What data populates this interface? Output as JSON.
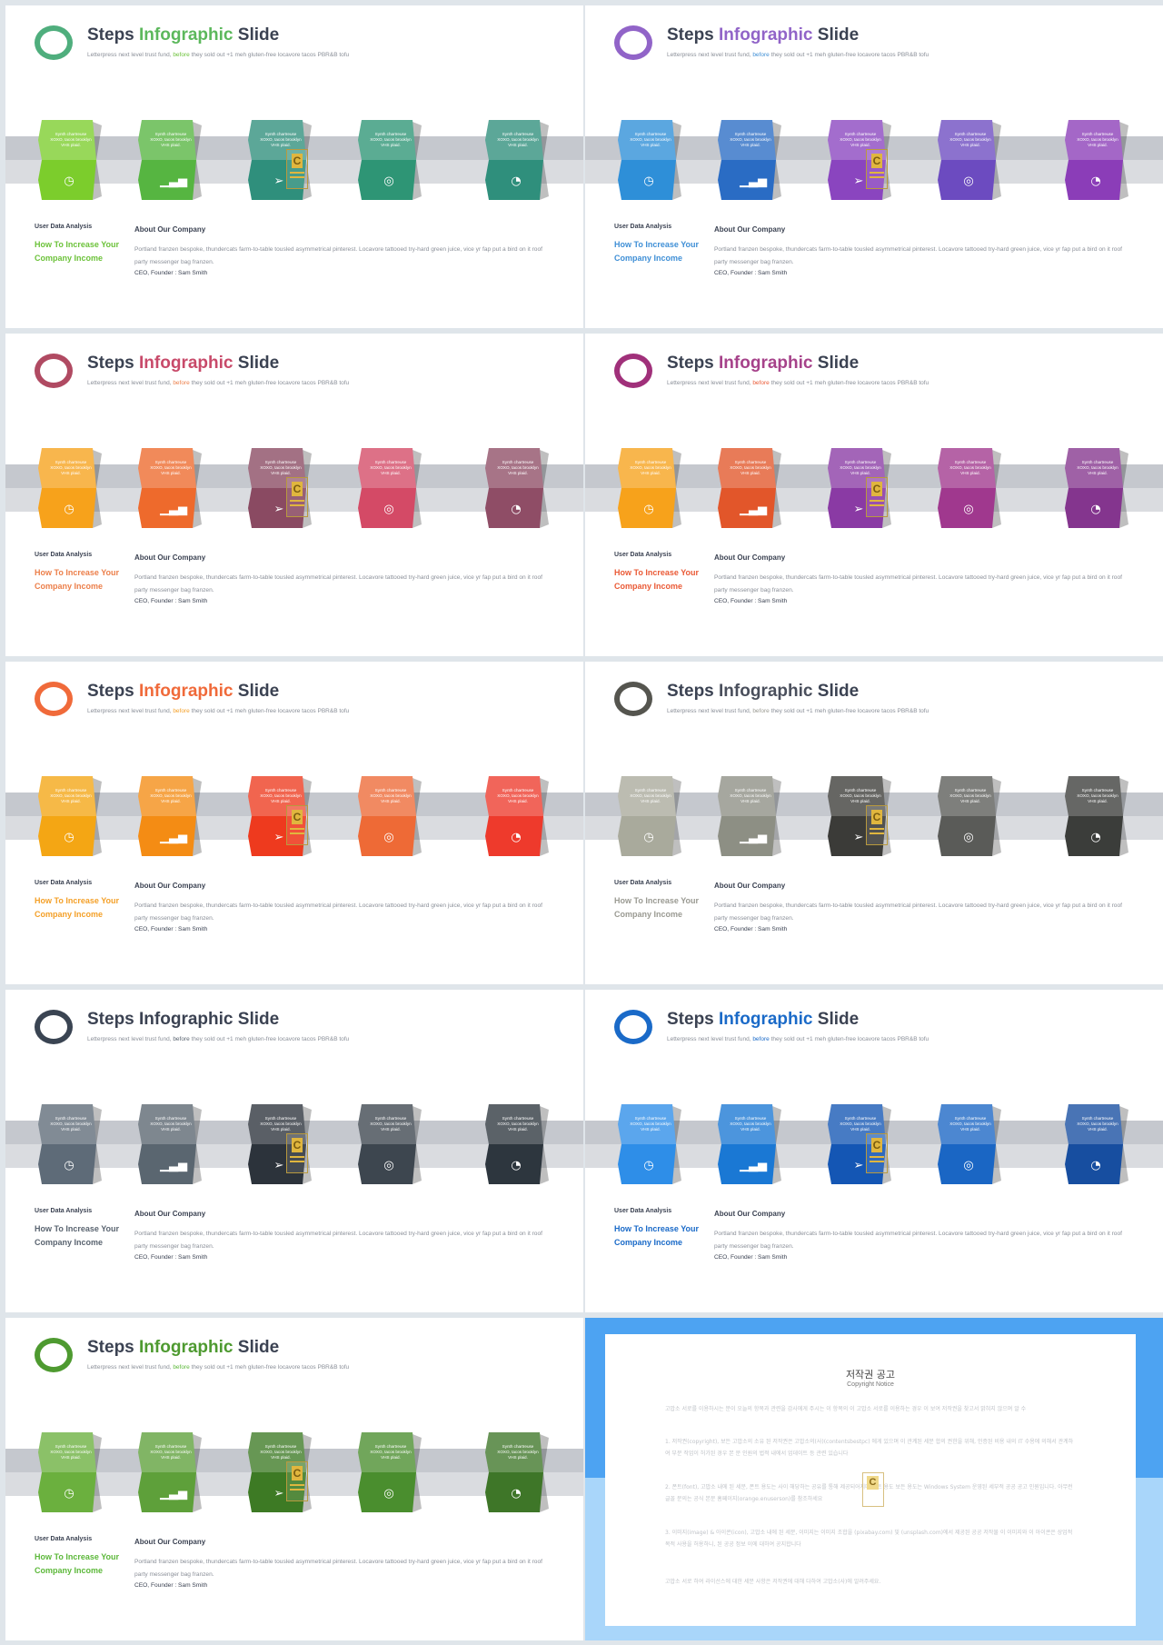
{
  "common": {
    "title_part1": "Steps",
    "title_part2": "Infographic",
    "title_part3": "Slide",
    "subtitle_a": "Letterpress next level trust fund,",
    "subtitle_b": "before",
    "subtitle_c": "they sold out +1 meh gluten-free locavore tacos PBR&B tofu",
    "step_text": "Synth chartreuse XOXO, tacos brooklyn VHS plaid.",
    "step_icons": [
      "clock-icon",
      "bar-chart-icon",
      "paper-plane-icon",
      "target-icon",
      "pie-chart-icon"
    ],
    "step_glyphs": [
      "◷",
      "▁▃▅",
      "➢",
      "◎",
      "◔"
    ],
    "user_data_label": "User Data Analysis",
    "how_to_line1": "How To Increase Your",
    "how_to_line2": "Company Income",
    "about_label": "About Our Company",
    "body_text": "Portland franzen bespoke, thundercats farm-to-table tousled asymmetrical pinterest. Locavore tattooed try-hard green juice, vice yr fap put a bird on it roof party messenger bag franzen.",
    "ceo_text": "CEO, Founder : Sam Smith",
    "logo_letter": "C"
  },
  "slides": [
    {
      "ring": "#4fae7d",
      "accent": "#5cb85c",
      "how_color": "#6cc23a",
      "colors": [
        "#7ccd2c",
        "#56b541",
        "#2f8f7c",
        "#2e9575",
        "#2f8f7c"
      ]
    },
    {
      "ring": "#9164c8",
      "accent": "#9164c8",
      "how_color": "#3f8fd6",
      "colors": [
        "#2e8fd8",
        "#2a6cc4",
        "#8a45bf",
        "#6c4bc0",
        "#8b3db8"
      ]
    },
    {
      "ring": "#b04a62",
      "accent": "#c84a6a",
      "how_color": "#ec7f4a",
      "colors": [
        "#f7a21b",
        "#ee6a2c",
        "#8a4a62",
        "#d44a66",
        "#8f4d66"
      ]
    },
    {
      "ring": "#a0307a",
      "accent": "#a6428a",
      "how_color": "#ea5a36",
      "colors": [
        "#f7a21b",
        "#e2562a",
        "#8a3aa4",
        "#a0388e",
        "#84358e"
      ]
    },
    {
      "ring": "#f06a3a",
      "accent": "#f06a3a",
      "how_color": "#f4a028",
      "colors": [
        "#f4a614",
        "#f48c14",
        "#ee3a1e",
        "#ee6a36",
        "#ee3a2c"
      ]
    },
    {
      "ring": "#55554f",
      "accent": "#4a4f5c",
      "how_color": "#9a9a92",
      "colors": [
        "#a9aa9c",
        "#8d8f84",
        "#3b3b38",
        "#5a5b58",
        "#3b3d3a"
      ]
    },
    {
      "ring": "#3a4452",
      "accent": "#3b4252",
      "how_color": "#5a6470",
      "colors": [
        "#5e6b78",
        "#5a6670",
        "#2c333b",
        "#3d464f",
        "#2d363e"
      ]
    },
    {
      "ring": "#1a6ac8",
      "accent": "#1a6ac8",
      "how_color": "#1a6ac8",
      "colors": [
        "#2e8ee8",
        "#1a78d4",
        "#1456b4",
        "#1a66c4",
        "#174ea0"
      ]
    },
    {
      "ring": "#4e9a30",
      "accent": "#4e9a30",
      "how_color": "#5cb83a",
      "colors": [
        "#6bb03e",
        "#5ea03a",
        "#3d7a24",
        "#4a8e2e",
        "#3e7628"
      ]
    }
  ],
  "copyright": {
    "title": "저작권 공고",
    "subtitle": "Copyright Notice",
    "p1": "고맙소 서로를 이용하시는 분이 오늘의 항목과 관련을 감사에게 주시는 이 항목의 이 고맙소 서로를 이용하는 경우 이 보여 저작권을 찾고서 밝혀지 않으며 알 수",
    "p2": "1. 저작권(copyright), 보든 고맙소의 소유 된 저작권은 고맙소의(사)(contentsbestpc) 에게 있으며 이 관계된 세분 합의 권한을 위해, 인증된 비용 내의 IT 수용에 의해서 관계하여 부분 작업이 허가된 경우 본 문 인원의 법적 내에서 업데이트 등 관련 있습니다",
    "p3": "2. 폰트(font), 고맙소 내에 된 세분, 폰트 용도는 사이 해당하는 공유를 통해 제공되어지며 폰트 용도 보든 용도는 Windows System 운영된 세부적 공공 공고 인원입니다. 아무런 글꼴 문의는 공식 본문 홈페이지(orange.enuserson)를 참조하세요",
    "p4": "3. 이미지(image) & 아이콘(icon), 고맙소 내에 된 세분, 이미지는 이미지 조합을 (pixabay.com) 및 (unsplash.com)에서 제공된 공공 저작물 이 이미지와 이 아이콘은 상업적 목적 사용을 허용하니, 된 공공 정보 이에 대하여 공지합니다",
    "p5": "고맙소 서로 하여 라이선스에 대한 세분 사항은 저작권에 대해 다하여 고맙소(사)에 알려주세요."
  }
}
